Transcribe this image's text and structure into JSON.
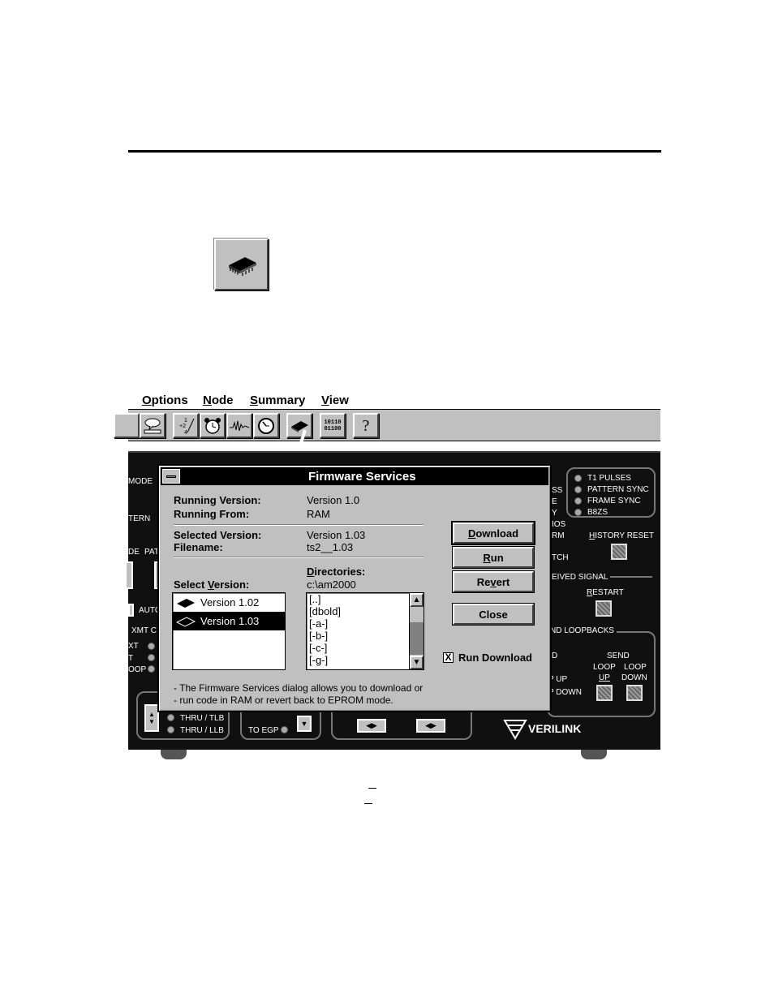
{
  "menu": {
    "items": [
      {
        "mnemonic": "O",
        "rest": "ptions"
      },
      {
        "mnemonic": "N",
        "rest": "ode"
      },
      {
        "mnemonic": "S",
        "rest": "ummary"
      },
      {
        "mnemonic": "V",
        "rest": "iew"
      }
    ]
  },
  "toolbar": {
    "binary_label_line1": "10110",
    "binary_label_line2": "01100",
    "help_label": "?"
  },
  "panel": {
    "left_labels": [
      "MODE",
      "TERN",
      "DE",
      "PAT",
      "AUTO",
      "XMT C",
      "XT",
      "T",
      "OOP"
    ],
    "leds": [
      {
        "label": "T1 PULSES"
      },
      {
        "label": "PATTERN SYNC"
      },
      {
        "label": "FRAME SYNC"
      },
      {
        "label": "B8ZS"
      }
    ],
    "right_labels": [
      "SS",
      "E",
      "Y",
      "IOS",
      "RM",
      "TCH"
    ],
    "history_reset": "HISTORY RESET",
    "history_reset_mnemonic": "H",
    "received_signal": "EIVED SIGNAL",
    "restart": "RESTART",
    "restart_mnemonic": "R",
    "loopbacks": "ND LOOPBACKS",
    "d_label": "D",
    "send": "SEND",
    "loop_up": "LOOP",
    "loop_up2": "UP",
    "loop_down": "LOOP",
    "loop_down2": "DOWN",
    "op_up": "P UP",
    "op_down": "P DOWN",
    "thru_tlb": "THRU / TLB",
    "thru_llb": "THRU / LLB",
    "to_egp": "TO EGP",
    "brand": "VERILINK"
  },
  "dialog": {
    "title": "Firmware Services",
    "running_version_label": "Running Version:",
    "running_version_value": "Version 1.0",
    "running_from_label": "Running From:",
    "running_from_value": "RAM",
    "selected_version_label": "Selected Version:",
    "selected_version_value": "Version 1.03",
    "filename_label": "Filename:",
    "filename_value": "ts2__1.03",
    "directories_label": "Directories:",
    "current_directory": "c:\\am2000",
    "select_version_label": "Select Version:",
    "versions": [
      {
        "label": "Version 1.02",
        "selected": false
      },
      {
        "label": "Version 1.03",
        "selected": true
      }
    ],
    "directories": [
      "[..]",
      "[dbold]",
      "[-a-]",
      "[-b-]",
      "[-c-]",
      "[-g-]"
    ],
    "buttons": {
      "download": {
        "mnemonic": "D",
        "rest": "ownload"
      },
      "run": {
        "mnemonic": "R",
        "rest": "un"
      },
      "revert_pre": "Re",
      "revert_mnemonic": "v",
      "revert_post": "ert",
      "close": "Close"
    },
    "run_download_checked": true,
    "run_download_label": "Run Download",
    "checkbox_mark": "X",
    "help_line1": "- The Firmware Services dialog allows you to download or",
    "help_line2": "- run code in RAM or revert back to EPROM mode."
  }
}
